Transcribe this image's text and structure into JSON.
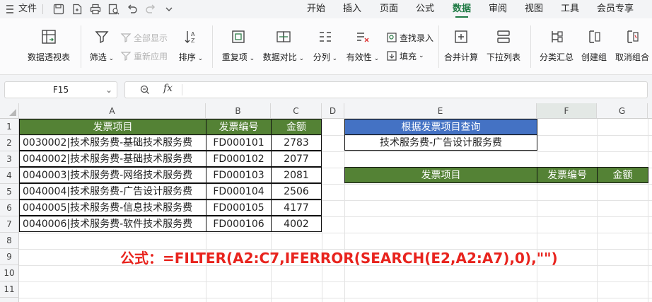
{
  "menubar": {
    "menu_icon": "hamburger-icon",
    "file_label": "文件",
    "tabs": [
      "开始",
      "插入",
      "页面",
      "公式",
      "数据",
      "审阅",
      "视图",
      "工具",
      "会员专享"
    ],
    "active_tab": "数据"
  },
  "ribbon": {
    "pivot_label": "数据透视表",
    "filter_label": "筛选",
    "show_all_label": "全部显示",
    "reapply_label": "重新应用",
    "sort_label": "排序",
    "duplicates_label": "重复项",
    "compare_label": "数据对比",
    "split_label": "分列",
    "validity_label": "有效性",
    "find_entry_label": "查找录入",
    "fill_label": "填充",
    "consolidate_label": "合并计算",
    "dropdown_list_label": "下拉列表",
    "subtotal_label": "分类汇总",
    "create_group_label": "创建组",
    "ungroup_label": "取消组合"
  },
  "formula_bar": {
    "name_box": "F15",
    "fx_label": "fx",
    "formula": ""
  },
  "columns": [
    "A",
    "B",
    "C",
    "D",
    "E",
    "F",
    "G"
  ],
  "rows": [
    "1",
    "2",
    "3",
    "4",
    "5",
    "6",
    "7",
    "8",
    "9",
    "10",
    "11"
  ],
  "table": {
    "headers": [
      "发票项目",
      "发票编号",
      "金额"
    ],
    "rows": [
      [
        "0030002|技术服务费-基础技术服务费",
        "FD000101",
        "2783"
      ],
      [
        "0040002|技术服务费-基础技术服务费",
        "FD000102",
        "2077"
      ],
      [
        "0040003|技术服务费-网络技术服务费",
        "FD000103",
        "2081"
      ],
      [
        "0040004|技术服务费-广告设计服务费",
        "FD000104",
        "2506"
      ],
      [
        "0040005|技术服务费-信息技术服务费",
        "FD000105",
        "4177"
      ],
      [
        "0040006|技术服务费-软件技术服务费",
        "FD000106",
        "4002"
      ]
    ]
  },
  "query": {
    "title": "根据发票项目查询",
    "value": "技术服务费-广告设计服务费"
  },
  "result": {
    "headers": [
      "发票项目",
      "发票编号",
      "金额"
    ]
  },
  "note": "公式：=FILTER(A2:C7,IFERROR(SEARCH(E2,A2:A7),0),\"\")",
  "colors": {
    "header_green": "#548235",
    "header_blue": "#4472c4",
    "accent_tab": "#1f7a44",
    "note_red": "#e8231d"
  }
}
